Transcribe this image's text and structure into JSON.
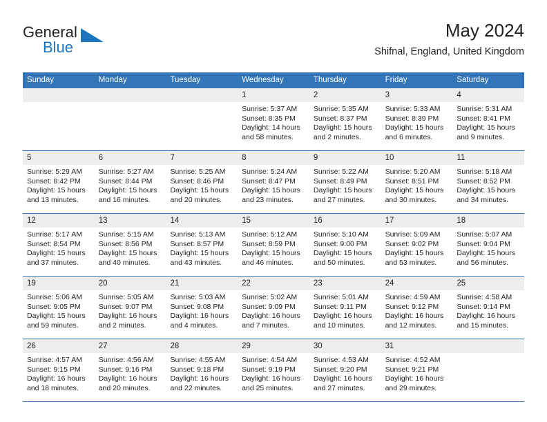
{
  "brand": {
    "name_top": "General",
    "name_bottom": "Blue",
    "triangle_color": "#1c75bc"
  },
  "header": {
    "title": "May 2024",
    "location": "Shifnal, England, United Kingdom"
  },
  "theme": {
    "header_blue": "#3275b8",
    "day_strip_gray": "#ededed",
    "text": "#231f20"
  },
  "weekdays": [
    "Sunday",
    "Monday",
    "Tuesday",
    "Wednesday",
    "Thursday",
    "Friday",
    "Saturday"
  ],
  "weeks": [
    [
      {
        "day": "",
        "empty": true
      },
      {
        "day": "",
        "empty": true
      },
      {
        "day": "",
        "empty": true
      },
      {
        "day": "1",
        "sunrise": "Sunrise: 5:37 AM",
        "sunset": "Sunset: 8:35 PM",
        "daylight_line1": "Daylight: 14 hours",
        "daylight_line2": "and 58 minutes."
      },
      {
        "day": "2",
        "sunrise": "Sunrise: 5:35 AM",
        "sunset": "Sunset: 8:37 PM",
        "daylight_line1": "Daylight: 15 hours",
        "daylight_line2": "and 2 minutes."
      },
      {
        "day": "3",
        "sunrise": "Sunrise: 5:33 AM",
        "sunset": "Sunset: 8:39 PM",
        "daylight_line1": "Daylight: 15 hours",
        "daylight_line2": "and 6 minutes."
      },
      {
        "day": "4",
        "sunrise": "Sunrise: 5:31 AM",
        "sunset": "Sunset: 8:41 PM",
        "daylight_line1": "Daylight: 15 hours",
        "daylight_line2": "and 9 minutes."
      }
    ],
    [
      {
        "day": "5",
        "sunrise": "Sunrise: 5:29 AM",
        "sunset": "Sunset: 8:42 PM",
        "daylight_line1": "Daylight: 15 hours",
        "daylight_line2": "and 13 minutes."
      },
      {
        "day": "6",
        "sunrise": "Sunrise: 5:27 AM",
        "sunset": "Sunset: 8:44 PM",
        "daylight_line1": "Daylight: 15 hours",
        "daylight_line2": "and 16 minutes."
      },
      {
        "day": "7",
        "sunrise": "Sunrise: 5:25 AM",
        "sunset": "Sunset: 8:46 PM",
        "daylight_line1": "Daylight: 15 hours",
        "daylight_line2": "and 20 minutes."
      },
      {
        "day": "8",
        "sunrise": "Sunrise: 5:24 AM",
        "sunset": "Sunset: 8:47 PM",
        "daylight_line1": "Daylight: 15 hours",
        "daylight_line2": "and 23 minutes."
      },
      {
        "day": "9",
        "sunrise": "Sunrise: 5:22 AM",
        "sunset": "Sunset: 8:49 PM",
        "daylight_line1": "Daylight: 15 hours",
        "daylight_line2": "and 27 minutes."
      },
      {
        "day": "10",
        "sunrise": "Sunrise: 5:20 AM",
        "sunset": "Sunset: 8:51 PM",
        "daylight_line1": "Daylight: 15 hours",
        "daylight_line2": "and 30 minutes."
      },
      {
        "day": "11",
        "sunrise": "Sunrise: 5:18 AM",
        "sunset": "Sunset: 8:52 PM",
        "daylight_line1": "Daylight: 15 hours",
        "daylight_line2": "and 34 minutes."
      }
    ],
    [
      {
        "day": "12",
        "sunrise": "Sunrise: 5:17 AM",
        "sunset": "Sunset: 8:54 PM",
        "daylight_line1": "Daylight: 15 hours",
        "daylight_line2": "and 37 minutes."
      },
      {
        "day": "13",
        "sunrise": "Sunrise: 5:15 AM",
        "sunset": "Sunset: 8:56 PM",
        "daylight_line1": "Daylight: 15 hours",
        "daylight_line2": "and 40 minutes."
      },
      {
        "day": "14",
        "sunrise": "Sunrise: 5:13 AM",
        "sunset": "Sunset: 8:57 PM",
        "daylight_line1": "Daylight: 15 hours",
        "daylight_line2": "and 43 minutes."
      },
      {
        "day": "15",
        "sunrise": "Sunrise: 5:12 AM",
        "sunset": "Sunset: 8:59 PM",
        "daylight_line1": "Daylight: 15 hours",
        "daylight_line2": "and 46 minutes."
      },
      {
        "day": "16",
        "sunrise": "Sunrise: 5:10 AM",
        "sunset": "Sunset: 9:00 PM",
        "daylight_line1": "Daylight: 15 hours",
        "daylight_line2": "and 50 minutes."
      },
      {
        "day": "17",
        "sunrise": "Sunrise: 5:09 AM",
        "sunset": "Sunset: 9:02 PM",
        "daylight_line1": "Daylight: 15 hours",
        "daylight_line2": "and 53 minutes."
      },
      {
        "day": "18",
        "sunrise": "Sunrise: 5:07 AM",
        "sunset": "Sunset: 9:04 PM",
        "daylight_line1": "Daylight: 15 hours",
        "daylight_line2": "and 56 minutes."
      }
    ],
    [
      {
        "day": "19",
        "sunrise": "Sunrise: 5:06 AM",
        "sunset": "Sunset: 9:05 PM",
        "daylight_line1": "Daylight: 15 hours",
        "daylight_line2": "and 59 minutes."
      },
      {
        "day": "20",
        "sunrise": "Sunrise: 5:05 AM",
        "sunset": "Sunset: 9:07 PM",
        "daylight_line1": "Daylight: 16 hours",
        "daylight_line2": "and 2 minutes."
      },
      {
        "day": "21",
        "sunrise": "Sunrise: 5:03 AM",
        "sunset": "Sunset: 9:08 PM",
        "daylight_line1": "Daylight: 16 hours",
        "daylight_line2": "and 4 minutes."
      },
      {
        "day": "22",
        "sunrise": "Sunrise: 5:02 AM",
        "sunset": "Sunset: 9:09 PM",
        "daylight_line1": "Daylight: 16 hours",
        "daylight_line2": "and 7 minutes."
      },
      {
        "day": "23",
        "sunrise": "Sunrise: 5:01 AM",
        "sunset": "Sunset: 9:11 PM",
        "daylight_line1": "Daylight: 16 hours",
        "daylight_line2": "and 10 minutes."
      },
      {
        "day": "24",
        "sunrise": "Sunrise: 4:59 AM",
        "sunset": "Sunset: 9:12 PM",
        "daylight_line1": "Daylight: 16 hours",
        "daylight_line2": "and 12 minutes."
      },
      {
        "day": "25",
        "sunrise": "Sunrise: 4:58 AM",
        "sunset": "Sunset: 9:14 PM",
        "daylight_line1": "Daylight: 16 hours",
        "daylight_line2": "and 15 minutes."
      }
    ],
    [
      {
        "day": "26",
        "sunrise": "Sunrise: 4:57 AM",
        "sunset": "Sunset: 9:15 PM",
        "daylight_line1": "Daylight: 16 hours",
        "daylight_line2": "and 18 minutes."
      },
      {
        "day": "27",
        "sunrise": "Sunrise: 4:56 AM",
        "sunset": "Sunset: 9:16 PM",
        "daylight_line1": "Daylight: 16 hours",
        "daylight_line2": "and 20 minutes."
      },
      {
        "day": "28",
        "sunrise": "Sunrise: 4:55 AM",
        "sunset": "Sunset: 9:18 PM",
        "daylight_line1": "Daylight: 16 hours",
        "daylight_line2": "and 22 minutes."
      },
      {
        "day": "29",
        "sunrise": "Sunrise: 4:54 AM",
        "sunset": "Sunset: 9:19 PM",
        "daylight_line1": "Daylight: 16 hours",
        "daylight_line2": "and 25 minutes."
      },
      {
        "day": "30",
        "sunrise": "Sunrise: 4:53 AM",
        "sunset": "Sunset: 9:20 PM",
        "daylight_line1": "Daylight: 16 hours",
        "daylight_line2": "and 27 minutes."
      },
      {
        "day": "31",
        "sunrise": "Sunrise: 4:52 AM",
        "sunset": "Sunset: 9:21 PM",
        "daylight_line1": "Daylight: 16 hours",
        "daylight_line2": "and 29 minutes."
      },
      {
        "day": "",
        "empty": true
      }
    ]
  ]
}
